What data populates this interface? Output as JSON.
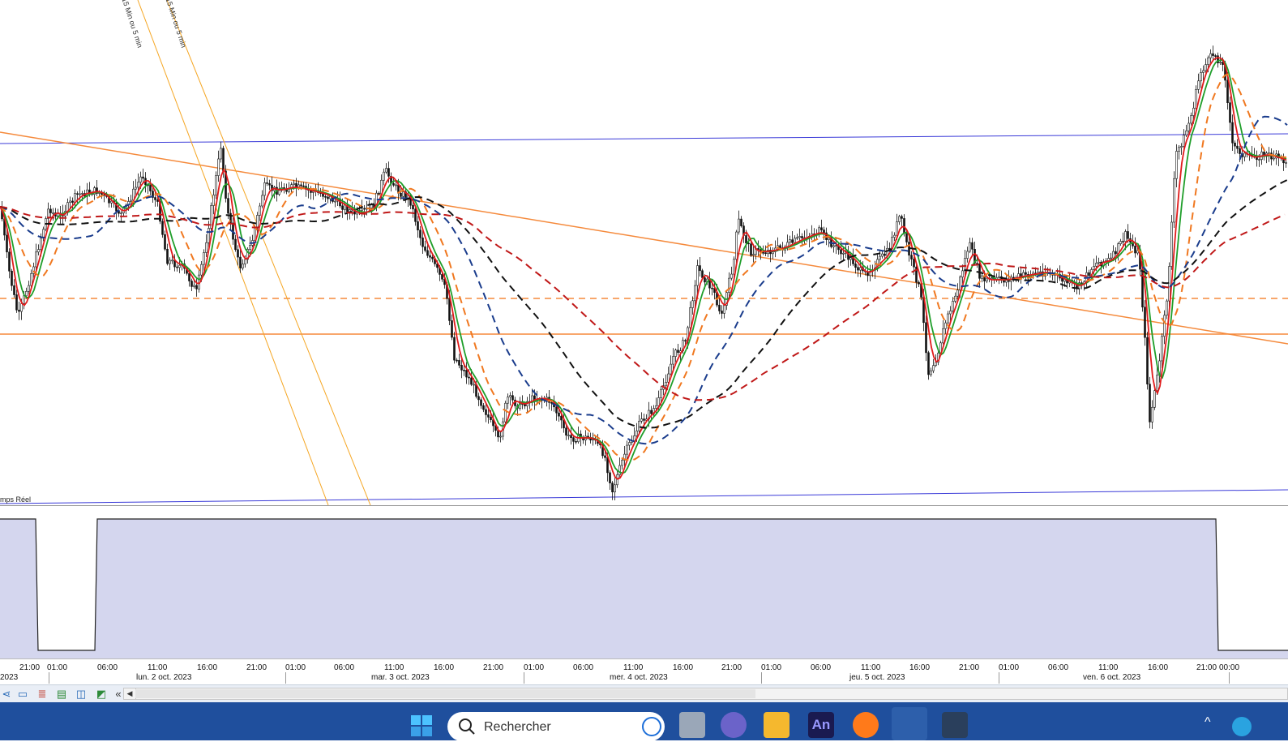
{
  "chart": {
    "drawing_labels": [
      "15 Min ou 5 min",
      "15 Min ou 5 min"
    ],
    "mode_label": "mps Réel"
  },
  "time_axis": {
    "ticks": [
      "21:00",
      "01:00",
      "06:00",
      "11:00",
      "16:00",
      "21:00",
      "01:00",
      "06:00",
      "11:00",
      "16:00",
      "21:00",
      "01:00",
      "06:00",
      "11:00",
      "16:00",
      "21:00",
      "01:00",
      "06:00",
      "11:00",
      "16:00",
      "21:00",
      "01:00",
      "06:00",
      "11:00",
      "16:00",
      "21:00",
      "00:00"
    ],
    "dates": [
      "2023",
      "lun. 2 oct. 2023",
      "mar. 3 oct. 2023",
      "mer. 4 oct. 2023",
      "jeu. 5 oct. 2023",
      "ven. 6 oct. 2023"
    ]
  },
  "toolbar": {
    "icons": [
      "share-icon",
      "chat-icon",
      "list-icon",
      "bars-icon",
      "window-chart-icon",
      "chart-up-icon"
    ],
    "collapse_glyph": "«",
    "scroll_left_glyph": "◀"
  },
  "taskbar": {
    "search_placeholder": "Rechercher",
    "apps": [
      "windows-start-icon",
      "bing-icon",
      "task-view-icon",
      "teams-icon",
      "file-explorer-icon",
      "animate-icon",
      "firefox-icon",
      "trading-app-icon",
      "security-app-icon"
    ],
    "animate_label": "An"
  },
  "colors": {
    "price": "#111111",
    "red_ma": "#e01b1b",
    "green_ma": "#1f9e2a",
    "orange_dashed": "#f07820",
    "navy_dashed": "#1a3c8c",
    "black_dashed": "#111111",
    "darkred_dashed": "#c01818",
    "channel_blue": "#3a3ad8",
    "trend_orange": "#f58a3c",
    "panel_fill": "#d4d6ee",
    "taskbar": "#1f4f9d"
  }
}
